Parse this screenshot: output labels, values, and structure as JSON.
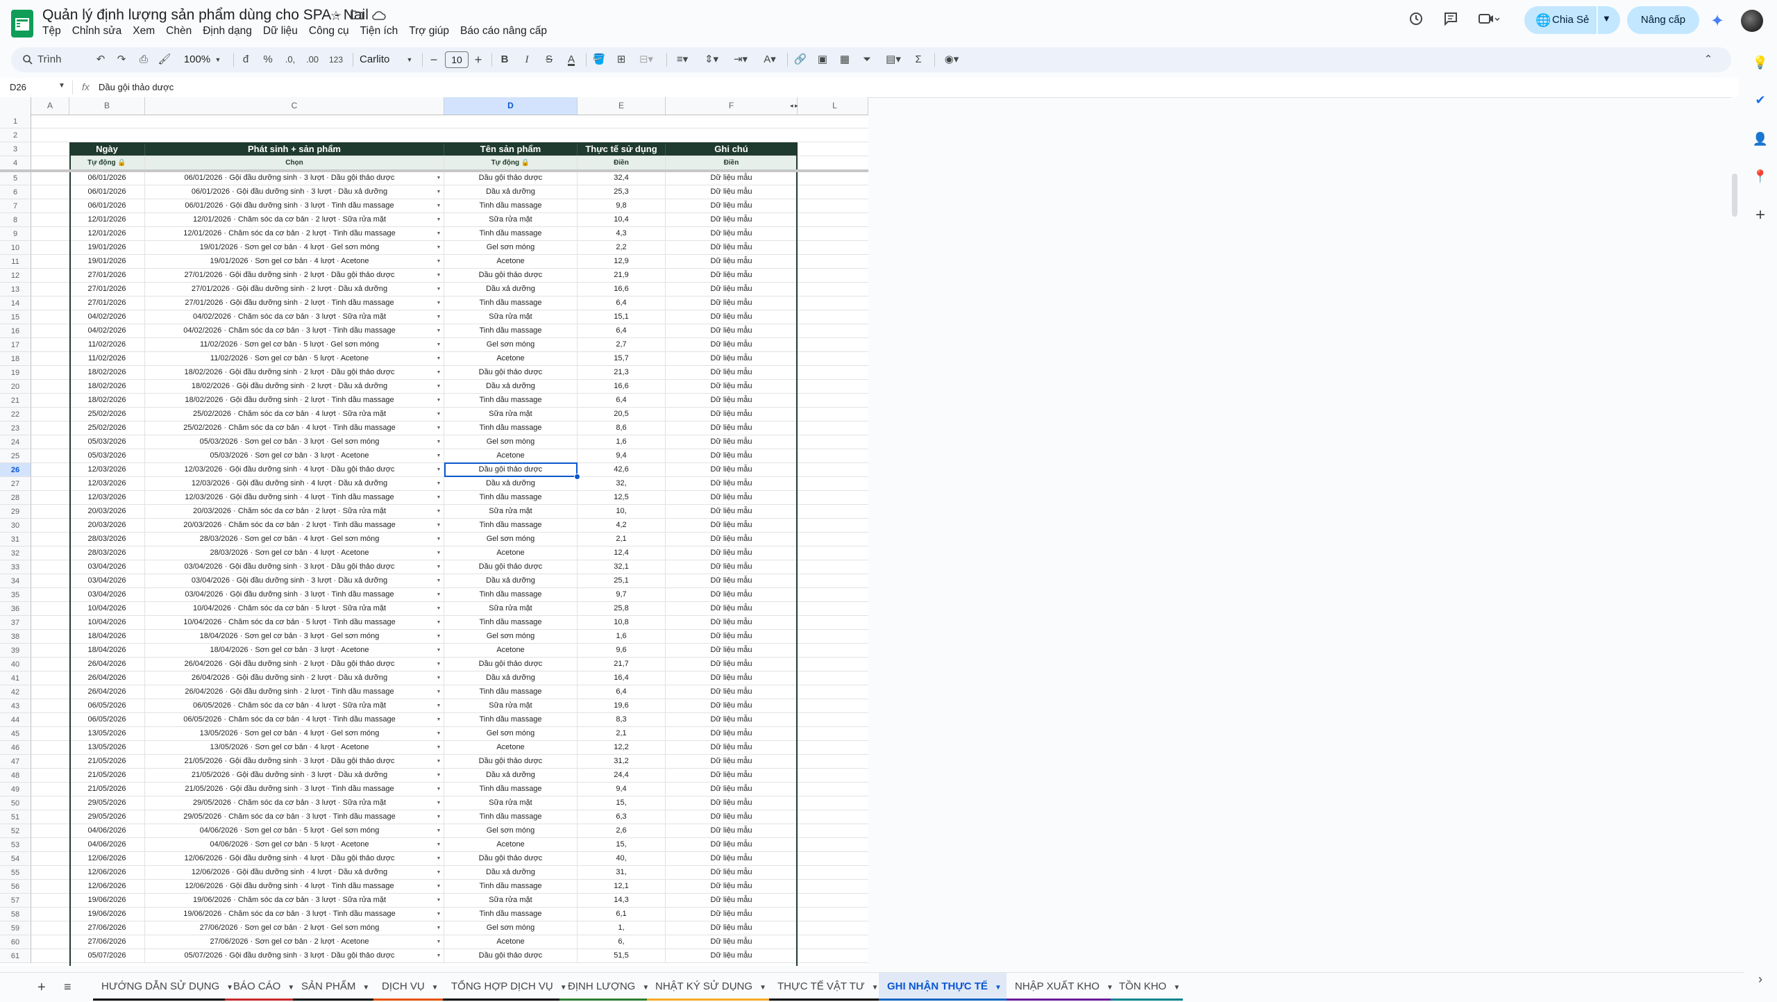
{
  "app": {
    "title": "Quản lý định lượng sản phẩm dùng cho SPA - Nail",
    "menu": [
      "Tệp",
      "Chỉnh sửa",
      "Xem",
      "Chèn",
      "Định dạng",
      "Dữ liệu",
      "Công cụ",
      "Tiện ích",
      "Trợ giúp",
      "Báo cáo nâng cấp"
    ],
    "share_label": "Chia Sẻ",
    "upgrade_label": "Nâng cấp"
  },
  "toolbar": {
    "search_label": "Trình đơn",
    "zoom": "100%",
    "currency": "đ",
    "percent": "%",
    "dec_decrease": ".0,",
    "dec_increase": ".00",
    "number_format": "123",
    "font": "Carlito",
    "font_size": "10",
    "bold": "B",
    "italic": "I",
    "strike": "S",
    "text_color": "A"
  },
  "formula": {
    "cell_ref": "D26",
    "fx": "fx",
    "content": "Dầu gội thảo dược"
  },
  "columns": [
    "A",
    "B",
    "C",
    "D",
    "E",
    "F",
    "L"
  ],
  "table": {
    "headers": [
      "Ngày",
      "Phát sinh + sản phẩm",
      "Tên sản phẩm",
      "Thực tế sử dụng",
      "Ghi chú"
    ],
    "subheaders": [
      "Tự động 🔒",
      "Chọn",
      "Tự động 🔒",
      "Điền",
      "Điền"
    ],
    "note": "Dữ liệu mẫu",
    "rows": [
      [
        "06/01/2026",
        "06/01/2026 · Gội đầu dưỡng sinh · 3 lượt · Dầu gội thảo dược",
        "Dầu gội thảo dược",
        "32,4"
      ],
      [
        "06/01/2026",
        "06/01/2026 · Gội đầu dưỡng sinh · 3 lượt · Dầu xả dưỡng",
        "Dầu xả dưỡng",
        "25,3"
      ],
      [
        "06/01/2026",
        "06/01/2026 · Gội đầu dưỡng sinh · 3 lượt · Tinh dầu massage",
        "Tinh dầu massage",
        "9,8"
      ],
      [
        "12/01/2026",
        "12/01/2026 · Chăm sóc da cơ bản · 2 lượt · Sữa rửa mặt",
        "Sữa rửa mặt",
        "10,4"
      ],
      [
        "12/01/2026",
        "12/01/2026 · Chăm sóc da cơ bản · 2 lượt · Tinh dầu massage",
        "Tinh dầu massage",
        "4,3"
      ],
      [
        "19/01/2026",
        "19/01/2026 · Sơn gel cơ bản · 4 lượt · Gel sơn móng",
        "Gel sơn móng",
        "2,2"
      ],
      [
        "19/01/2026",
        "19/01/2026 · Sơn gel cơ bản · 4 lượt · Acetone",
        "Acetone",
        "12,9"
      ],
      [
        "27/01/2026",
        "27/01/2026 · Gội đầu dưỡng sinh · 2 lượt · Dầu gội thảo dược",
        "Dầu gội thảo dược",
        "21,9"
      ],
      [
        "27/01/2026",
        "27/01/2026 · Gội đầu dưỡng sinh · 2 lượt · Dầu xả dưỡng",
        "Dầu xả dưỡng",
        "16,6"
      ],
      [
        "27/01/2026",
        "27/01/2026 · Gội đầu dưỡng sinh · 2 lượt · Tinh dầu massage",
        "Tinh dầu massage",
        "6,4"
      ],
      [
        "04/02/2026",
        "04/02/2026 · Chăm sóc da cơ bản · 3 lượt · Sữa rửa mặt",
        "Sữa rửa mặt",
        "15,1"
      ],
      [
        "04/02/2026",
        "04/02/2026 · Chăm sóc da cơ bản · 3 lượt · Tinh dầu massage",
        "Tinh dầu massage",
        "6,4"
      ],
      [
        "11/02/2026",
        "11/02/2026 · Sơn gel cơ bản · 5 lượt · Gel sơn móng",
        "Gel sơn móng",
        "2,7"
      ],
      [
        "11/02/2026",
        "11/02/2026 · Sơn gel cơ bản · 5 lượt · Acetone",
        "Acetone",
        "15,7"
      ],
      [
        "18/02/2026",
        "18/02/2026 · Gội đầu dưỡng sinh · 2 lượt · Dầu gội thảo dược",
        "Dầu gội thảo dược",
        "21,3"
      ],
      [
        "18/02/2026",
        "18/02/2026 · Gội đầu dưỡng sinh · 2 lượt · Dầu xả dưỡng",
        "Dầu xả dưỡng",
        "16,6"
      ],
      [
        "18/02/2026",
        "18/02/2026 · Gội đầu dưỡng sinh · 2 lượt · Tinh dầu massage",
        "Tinh dầu massage",
        "6,4"
      ],
      [
        "25/02/2026",
        "25/02/2026 · Chăm sóc da cơ bản · 4 lượt · Sữa rửa mặt",
        "Sữa rửa mặt",
        "20,5"
      ],
      [
        "25/02/2026",
        "25/02/2026 · Chăm sóc da cơ bản · 4 lượt · Tinh dầu massage",
        "Tinh dầu massage",
        "8,6"
      ],
      [
        "05/03/2026",
        "05/03/2026 · Sơn gel cơ bản · 3 lượt · Gel sơn móng",
        "Gel sơn móng",
        "1,6"
      ],
      [
        "05/03/2026",
        "05/03/2026 · Sơn gel cơ bản · 3 lượt · Acetone",
        "Acetone",
        "9,4"
      ],
      [
        "12/03/2026",
        "12/03/2026 · Gội đầu dưỡng sinh · 4 lượt · Dầu gội thảo dược",
        "Dầu gội thảo dược",
        "42,6"
      ],
      [
        "12/03/2026",
        "12/03/2026 · Gội đầu dưỡng sinh · 4 lượt · Dầu xả dưỡng",
        "Dầu xả dưỡng",
        "32,"
      ],
      [
        "12/03/2026",
        "12/03/2026 · Gội đầu dưỡng sinh · 4 lượt · Tinh dầu massage",
        "Tinh dầu massage",
        "12,5"
      ],
      [
        "20/03/2026",
        "20/03/2026 · Chăm sóc da cơ bản · 2 lượt · Sữa rửa mặt",
        "Sữa rửa mặt",
        "10,"
      ],
      [
        "20/03/2026",
        "20/03/2026 · Chăm sóc da cơ bản · 2 lượt · Tinh dầu massage",
        "Tinh dầu massage",
        "4,2"
      ],
      [
        "28/03/2026",
        "28/03/2026 · Sơn gel cơ bản · 4 lượt · Gel sơn móng",
        "Gel sơn móng",
        "2,1"
      ],
      [
        "28/03/2026",
        "28/03/2026 · Sơn gel cơ bản · 4 lượt · Acetone",
        "Acetone",
        "12,4"
      ],
      [
        "03/04/2026",
        "03/04/2026 · Gội đầu dưỡng sinh · 3 lượt · Dầu gội thảo dược",
        "Dầu gội thảo dược",
        "32,1"
      ],
      [
        "03/04/2026",
        "03/04/2026 · Gội đầu dưỡng sinh · 3 lượt · Dầu xả dưỡng",
        "Dầu xả dưỡng",
        "25,1"
      ],
      [
        "03/04/2026",
        "03/04/2026 · Gội đầu dưỡng sinh · 3 lượt · Tinh dầu massage",
        "Tinh dầu massage",
        "9,7"
      ],
      [
        "10/04/2026",
        "10/04/2026 · Chăm sóc da cơ bản · 5 lượt · Sữa rửa mặt",
        "Sữa rửa mặt",
        "25,8"
      ],
      [
        "10/04/2026",
        "10/04/2026 · Chăm sóc da cơ bản · 5 lượt · Tinh dầu massage",
        "Tinh dầu massage",
        "10,8"
      ],
      [
        "18/04/2026",
        "18/04/2026 · Sơn gel cơ bản · 3 lượt · Gel sơn móng",
        "Gel sơn móng",
        "1,6"
      ],
      [
        "18/04/2026",
        "18/04/2026 · Sơn gel cơ bản · 3 lượt · Acetone",
        "Acetone",
        "9,6"
      ],
      [
        "26/04/2026",
        "26/04/2026 · Gội đầu dưỡng sinh · 2 lượt · Dầu gội thảo dược",
        "Dầu gội thảo dược",
        "21,7"
      ],
      [
        "26/04/2026",
        "26/04/2026 · Gội đầu dưỡng sinh · 2 lượt · Dầu xả dưỡng",
        "Dầu xả dưỡng",
        "16,4"
      ],
      [
        "26/04/2026",
        "26/04/2026 · Gội đầu dưỡng sinh · 2 lượt · Tinh dầu massage",
        "Tinh dầu massage",
        "6,4"
      ],
      [
        "06/05/2026",
        "06/05/2026 · Chăm sóc da cơ bản · 4 lượt · Sữa rửa mặt",
        "Sữa rửa mặt",
        "19,6"
      ],
      [
        "06/05/2026",
        "06/05/2026 · Chăm sóc da cơ bản · 4 lượt · Tinh dầu massage",
        "Tinh dầu massage",
        "8,3"
      ],
      [
        "13/05/2026",
        "13/05/2026 · Sơn gel cơ bản · 4 lượt · Gel sơn móng",
        "Gel sơn móng",
        "2,1"
      ],
      [
        "13/05/2026",
        "13/05/2026 · Sơn gel cơ bản · 4 lượt · Acetone",
        "Acetone",
        "12,2"
      ],
      [
        "21/05/2026",
        "21/05/2026 · Gội đầu dưỡng sinh · 3 lượt · Dầu gội thảo dược",
        "Dầu gội thảo dược",
        "31,2"
      ],
      [
        "21/05/2026",
        "21/05/2026 · Gội đầu dưỡng sinh · 3 lượt · Dầu xả dưỡng",
        "Dầu xả dưỡng",
        "24,4"
      ],
      [
        "21/05/2026",
        "21/05/2026 · Gội đầu dưỡng sinh · 3 lượt · Tinh dầu massage",
        "Tinh dầu massage",
        "9,4"
      ],
      [
        "29/05/2026",
        "29/05/2026 · Chăm sóc da cơ bản · 3 lượt · Sữa rửa mặt",
        "Sữa rửa mặt",
        "15,"
      ],
      [
        "29/05/2026",
        "29/05/2026 · Chăm sóc da cơ bản · 3 lượt · Tinh dầu massage",
        "Tinh dầu massage",
        "6,3"
      ],
      [
        "04/06/2026",
        "04/06/2026 · Sơn gel cơ bản · 5 lượt · Gel sơn móng",
        "Gel sơn móng",
        "2,6"
      ],
      [
        "04/06/2026",
        "04/06/2026 · Sơn gel cơ bản · 5 lượt · Acetone",
        "Acetone",
        "15,"
      ],
      [
        "12/06/2026",
        "12/06/2026 · Gội đầu dưỡng sinh · 4 lượt · Dầu gội thảo dược",
        "Dầu gội thảo dược",
        "40,"
      ],
      [
        "12/06/2026",
        "12/06/2026 · Gội đầu dưỡng sinh · 4 lượt · Dầu xả dưỡng",
        "Dầu xả dưỡng",
        "31,"
      ],
      [
        "12/06/2026",
        "12/06/2026 · Gội đầu dưỡng sinh · 4 lượt · Tinh dầu massage",
        "Tinh dầu massage",
        "12,1"
      ],
      [
        "19/06/2026",
        "19/06/2026 · Chăm sóc da cơ bản · 3 lượt · Sữa rửa mặt",
        "Sữa rửa mặt",
        "14,3"
      ],
      [
        "19/06/2026",
        "19/06/2026 · Chăm sóc da cơ bản · 3 lượt · Tinh dầu massage",
        "Tinh dầu massage",
        "6,1"
      ],
      [
        "27/06/2026",
        "27/06/2026 · Sơn gel cơ bản · 2 lượt · Gel sơn móng",
        "Gel sơn móng",
        "1,"
      ],
      [
        "27/06/2026",
        "27/06/2026 · Sơn gel cơ bản · 2 lượt · Acetone",
        "Acetone",
        "6,"
      ],
      [
        "05/07/2026",
        "05/07/2026 · Gội đầu dưỡng sinh · 3 lượt · Dầu gội thảo dược",
        "Dầu gội thảo dược",
        "51,5"
      ]
    ]
  },
  "sheets": [
    {
      "name": "HƯỚNG DẪN SỬ DỤNG",
      "color": "#000000"
    },
    {
      "name": "BÁO CÁO",
      "color": "#c62828"
    },
    {
      "name": "SẢN PHẨM",
      "color": "#000000"
    },
    {
      "name": "DỊCH VỤ",
      "color": "#e65100"
    },
    {
      "name": "TỔNG HỢP DỊCH VỤ",
      "color": "#000000"
    },
    {
      "name": "ĐỊNH LƯỢNG",
      "color": "#2e7d32"
    },
    {
      "name": "NHẬT KÝ SỬ DỤNG",
      "color": "#f9a825"
    },
    {
      "name": "THỰC TẾ VẬT TƯ",
      "color": "#000000"
    },
    {
      "name": "GHI NHẬN THỰC TẾ",
      "color": "#1565c0",
      "active": true
    },
    {
      "name": "NHẬP XUẤT KHO",
      "color": "#6a1b9a"
    },
    {
      "name": "TỒN KHO",
      "color": "#00838f"
    }
  ],
  "colors": {
    "header_bg": "#1f3a2e",
    "subheader_bg": "#e6efe9",
    "accent": "#0b57d0"
  }
}
